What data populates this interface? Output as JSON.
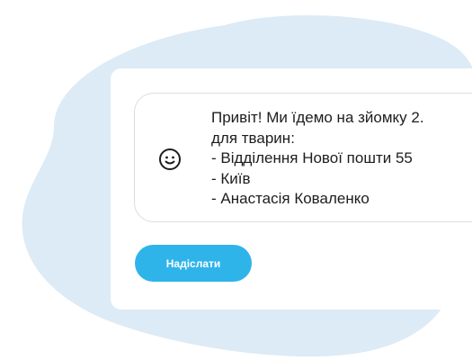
{
  "message": {
    "text": "Привіт! Ми їдемо на зйомку 2.\nдля тварин:\n- Відділення Нової пошти 55\n- Київ\n- Анастасія Коваленко"
  },
  "actions": {
    "send_label": "Надіслати"
  },
  "icons": {
    "smiley": "smiley-face-icon"
  },
  "colors": {
    "background_blob": "#dcebf6",
    "card": "#ffffff",
    "message_border": "#d9dde2",
    "button": "#2fb4ea",
    "button_text": "#ffffff",
    "text": "#1d1d1d"
  }
}
